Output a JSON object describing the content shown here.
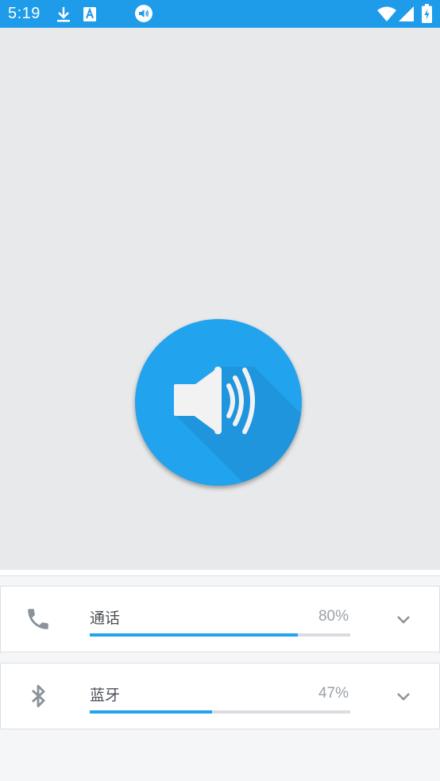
{
  "status_bar": {
    "time": "5:19",
    "background": "#1e9be9",
    "icons_left": [
      "download-icon",
      "font-a-icon",
      "volume-notification-icon"
    ],
    "icons_right": [
      "wifi-icon",
      "signal-icon",
      "battery-charging-icon"
    ]
  },
  "hero": {
    "icon": "speaker-volume-icon",
    "circle_color": "#22a3ee"
  },
  "volume_items": [
    {
      "icon": "phone-icon",
      "label": "通话",
      "percent_text": "80%",
      "level": 0.8,
      "expand_icon": "chevron-down-icon"
    },
    {
      "icon": "bluetooth-icon",
      "label": "蓝牙",
      "percent_text": "47%",
      "level": 0.47,
      "expand_icon": "chevron-down-icon"
    }
  ],
  "colors": {
    "accent": "#22a3ee",
    "track": "#d9dde1"
  }
}
